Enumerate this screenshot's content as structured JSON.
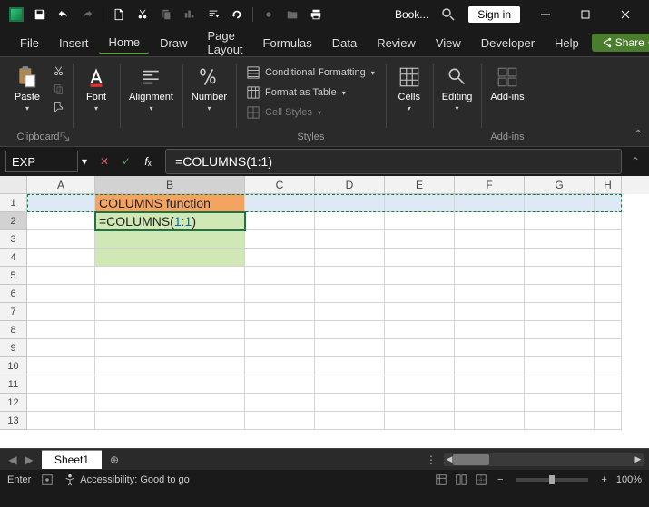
{
  "title": "Book...",
  "signin": "Sign in",
  "menu": {
    "items": [
      "File",
      "Insert",
      "Home",
      "Draw",
      "Page Layout",
      "Formulas",
      "Data",
      "Review",
      "View",
      "Developer",
      "Help"
    ],
    "active": "Home",
    "share": "Share"
  },
  "ribbon": {
    "clipboard": {
      "label": "Clipboard",
      "paste": "Paste"
    },
    "font": {
      "label": "Font",
      "btn": "Font"
    },
    "alignment": {
      "label": "Alignment",
      "btn": "Alignment"
    },
    "number": {
      "label": "Number",
      "btn": "Number"
    },
    "styles": {
      "label": "Styles",
      "cf": "Conditional Formatting",
      "fat": "Format as Table",
      "cs": "Cell Styles"
    },
    "cells": {
      "label": "Cells",
      "btn": "Cells"
    },
    "editing": {
      "label": "Editing",
      "btn": "Editing"
    },
    "addins": {
      "label": "Add-ins",
      "btn": "Add-ins"
    }
  },
  "namebox": "EXP",
  "formula": "=COLUMNS(1:1)",
  "columns": [
    "A",
    "B",
    "C",
    "D",
    "E",
    "F",
    "G",
    "H"
  ],
  "rowcount": 13,
  "cells": {
    "B1": "COLUMNS function",
    "B2_prefix": "=COLUMNS(",
    "B2_ref": "1:1",
    "B2_suffix": ")"
  },
  "sheet": {
    "name": "Sheet1"
  },
  "status": {
    "mode": "Enter",
    "acc": "Accessibility: Good to go",
    "zoom": "100%"
  },
  "colwidths": {
    "A": 75,
    "B": 165,
    "C": 77,
    "D": 77,
    "E": 77,
    "F": 77,
    "G": 77,
    "H": 30
  }
}
